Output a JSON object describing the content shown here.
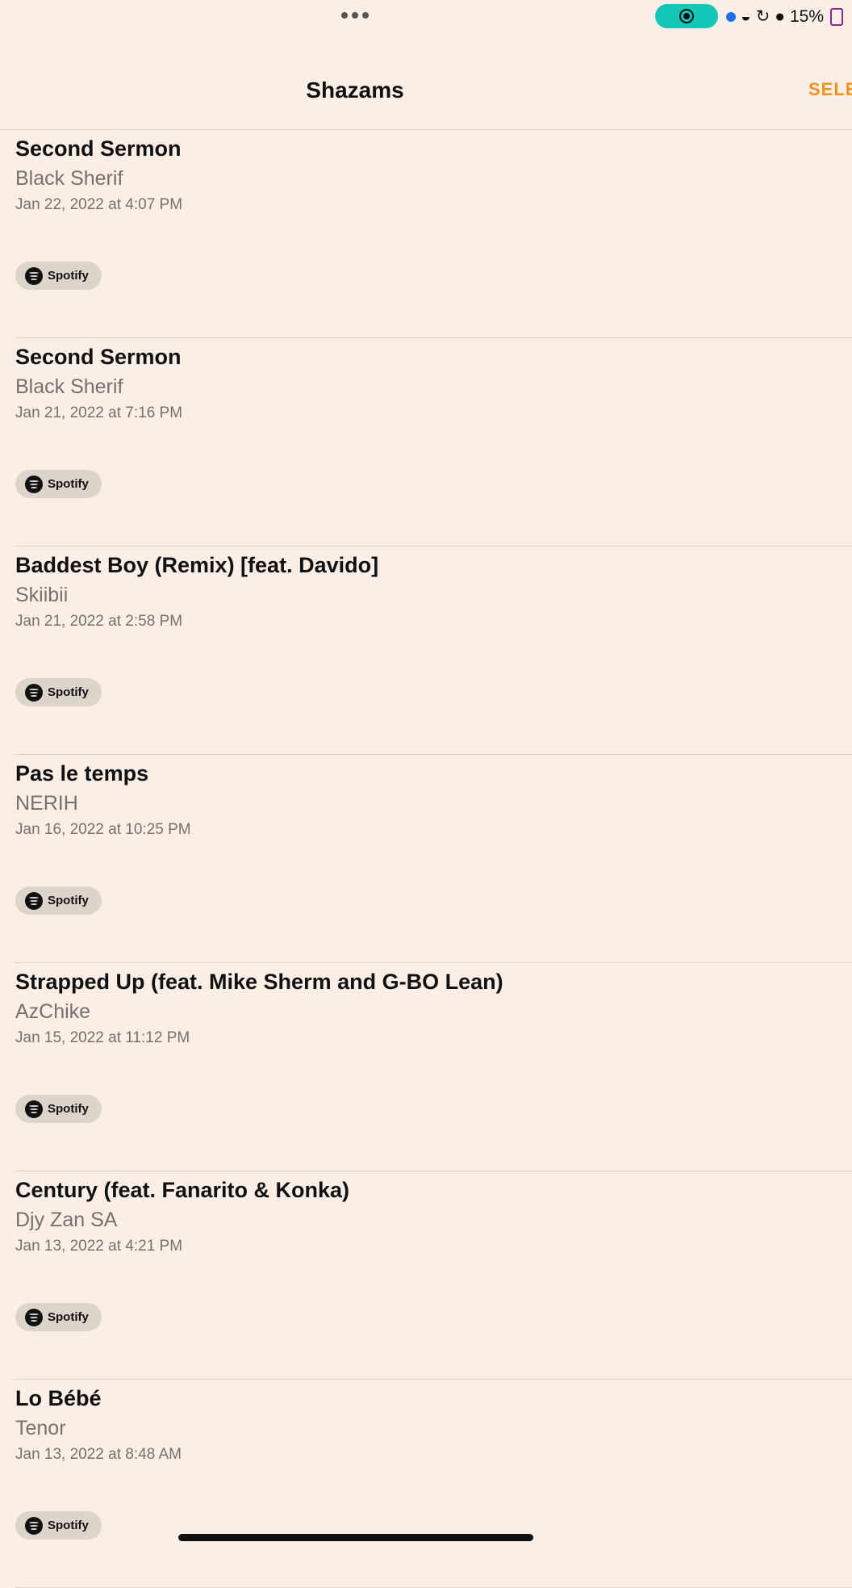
{
  "status_bar": {
    "battery_percent": "15%"
  },
  "nav": {
    "title": "Shazams",
    "select_label": "SELE"
  },
  "items": [
    {
      "title": "Second Sermon",
      "artist": "Black Sherif",
      "date": "Jan 22, 2022 at 4:07 PM",
      "service": "Spotify"
    },
    {
      "title": "Second Sermon",
      "artist": "Black Sherif",
      "date": "Jan 21, 2022 at 7:16 PM",
      "service": "Spotify"
    },
    {
      "title": "Baddest Boy (Remix) [feat. Davido]",
      "artist": "Skiibii",
      "date": "Jan 21, 2022 at 2:58 PM",
      "service": "Spotify"
    },
    {
      "title": "Pas le temps",
      "artist": "NERIH",
      "date": "Jan 16, 2022 at 10:25 PM",
      "service": "Spotify"
    },
    {
      "title": "Strapped Up (feat. Mike Sherm and G-BO Lean)",
      "artist": "AzChike",
      "date": "Jan 15, 2022 at 11:12 PM",
      "service": "Spotify"
    },
    {
      "title": "Century (feat. Fanarito & Konka)",
      "artist": "Djy Zan SA",
      "date": "Jan 13, 2022 at 4:21 PM",
      "service": "Spotify"
    },
    {
      "title": "Lo Bébé",
      "artist": "Tenor",
      "date": "Jan 13, 2022 at 8:48 AM",
      "service": "Spotify"
    }
  ]
}
